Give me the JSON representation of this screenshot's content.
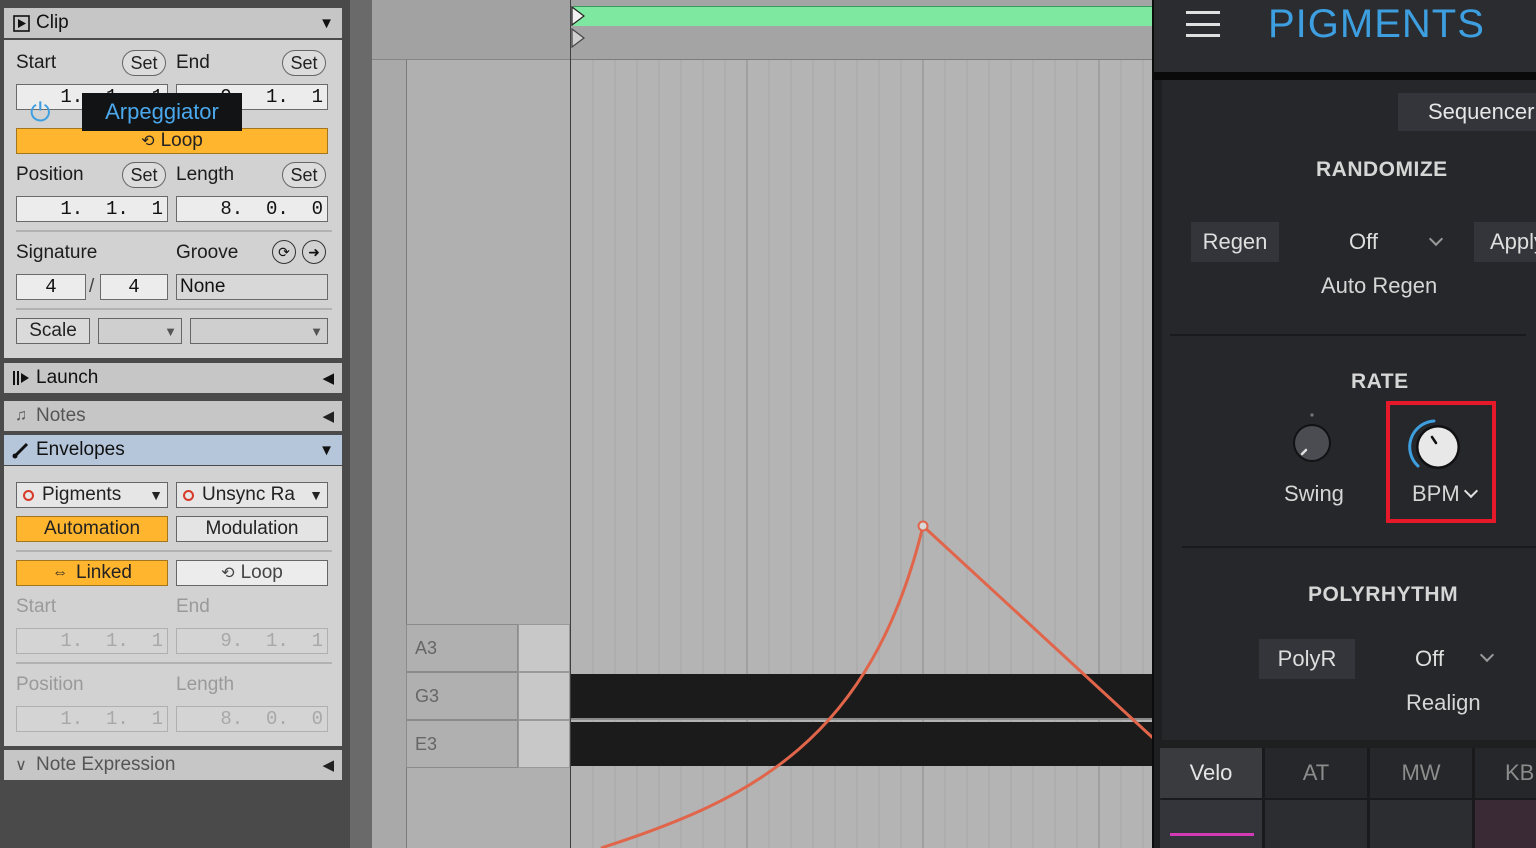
{
  "clip": {
    "header": "Clip",
    "start_label": "Start",
    "end_label": "End",
    "set_label": "Set",
    "start_value": "1.  1.  1",
    "end_value": "9.  1.  1",
    "loop_label": "Loop",
    "position_label": "Position",
    "length_label": "Length",
    "position_value": "1.  1.  1",
    "length_value": "8.  0.  0",
    "signature_label": "Signature",
    "groove_label": "Groove",
    "sig_numerator": "4",
    "sig_slash": "/",
    "sig_denominator": "4",
    "groove_value": "None",
    "scale_label": "Scale"
  },
  "sections": {
    "launch": "Launch",
    "notes": "Notes",
    "envelopes": "Envelopes",
    "note_expression": "Note Expression"
  },
  "envelopes": {
    "device": "Pigments",
    "parameter": "Unsync Ra",
    "automation_label": "Automation",
    "modulation_label": "Modulation",
    "linked_label": "Linked",
    "loop_label": "Loop",
    "start_label": "Start",
    "end_label": "End",
    "start_value": "1.  1.  1",
    "end_value": "9.  1.  1",
    "position_label": "Position",
    "length_label": "Length",
    "position_value": "1.  1.  1",
    "length_value": "8.  0.  0"
  },
  "piano": {
    "keys": [
      "A3",
      "G3",
      "E3"
    ]
  },
  "pigments": {
    "brand": "PIGMENTS",
    "tabs": [
      "Arpeggiator",
      "Sequencer"
    ],
    "randomize": {
      "title": "RANDOMIZE",
      "regen": "Regen",
      "off": "Off",
      "apply": "Apply",
      "auto_regen": "Auto Regen"
    },
    "rate": {
      "title": "RATE",
      "swing": "Swing",
      "bpm": "BPM"
    },
    "polyrhythm": {
      "title": "POLYRHYTHM",
      "polyr": "PolyR",
      "off": "Off",
      "realign": "Realign"
    },
    "bottom_tabs": [
      "Velo",
      "AT",
      "MW",
      "KBD"
    ]
  },
  "colors": {
    "loop_orange": "#ffb52e",
    "clip_green": "#7ee8a0",
    "envelope_line": "#e0654a",
    "pigments_blue": "#3d9fe0",
    "highlight_red": "#e6192a"
  }
}
